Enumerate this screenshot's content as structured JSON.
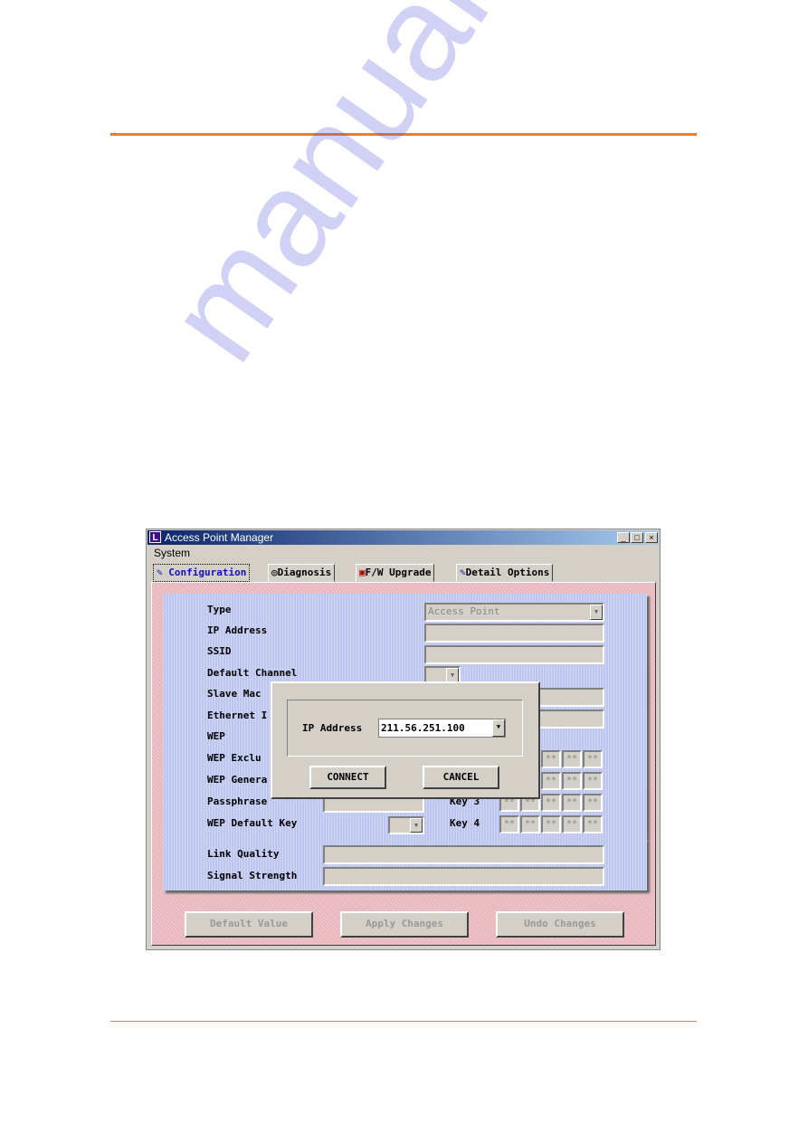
{
  "colors": {
    "accent_rule": "#f07a1e",
    "tab_active": "#1010c0",
    "title_bar": "#0a246a"
  },
  "watermark": "manuals.plus",
  "window": {
    "title": "Access Point Manager",
    "controls": {
      "minimize": "_",
      "maximize": "□",
      "close": "×"
    },
    "menu": [
      "System"
    ],
    "tabs": [
      {
        "label": "Configuration",
        "icon": "config-tool-icon",
        "active": true
      },
      {
        "label": "Diagnosis",
        "icon": "stethoscope-icon"
      },
      {
        "label": "F/W Upgrade",
        "icon": "firmware-upgrade-icon"
      },
      {
        "label": "Detail Options",
        "icon": "pencil-icon"
      }
    ],
    "config": {
      "labels": [
        "Type",
        "IP Address",
        "SSID",
        "Default Channel",
        "Slave Mac",
        "Ethernet I",
        "WEP",
        "WEP Exclu",
        "WEP Genera",
        "Passphrase",
        "WEP Default Key"
      ],
      "type_value": "Access Point",
      "key_labels": [
        "Key 3",
        "Key 4"
      ],
      "key_placeholder": "**"
    },
    "status": {
      "labels": [
        "Link Quality",
        "Signal Strength"
      ]
    },
    "buttons": {
      "default": "Default Value",
      "apply": "Apply Changes",
      "undo": "Undo Changes"
    }
  },
  "dialog": {
    "ip_label": "IP Address",
    "ip_value": "211.56.251.100",
    "connect": "CONNECT",
    "cancel": "CANCEL"
  }
}
